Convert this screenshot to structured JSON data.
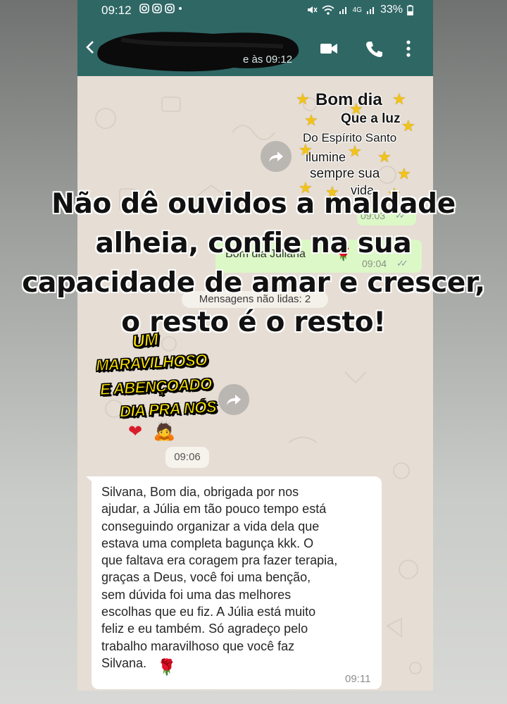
{
  "status_bar": {
    "time": "09:12",
    "left_icons": [
      "instagram-icon",
      "instagram-icon",
      "instagram-icon",
      "dot-icon"
    ],
    "right_icons": [
      "mute-icon",
      "wifi-icon",
      "signal-icon",
      "4g-icon",
      "signal-icon"
    ],
    "network": "4G",
    "battery": "33%"
  },
  "header": {
    "last_seen": "e às 09:12",
    "actions": [
      "video-call-icon",
      "phone-call-icon",
      "more-vert-icon"
    ]
  },
  "chat": {
    "sticker_bom_dia": {
      "lines": [
        "Bom dia",
        "Que a luz",
        "Do Espírito Santo",
        "ilumine",
        "sempre sua",
        "vida"
      ],
      "time": "09:03"
    },
    "outgoing_message": {
      "text": "Bom dia Juliana",
      "emoji": "🌹",
      "time": "09:04"
    },
    "unread_divider": "Mensagens não lidas: 2",
    "sticker_maravilhoso": {
      "lines": [
        "UM",
        "MARAVILHOSO",
        "E ABENÇOADO",
        "DIA PRA NÓS"
      ],
      "emojis": [
        "❤",
        "🙇"
      ]
    },
    "sticker_time": "09:06",
    "incoming_message": {
      "text": "Silvana, Bom dia, obrigada por nos\najudar, a Júlia em tão pouco tempo está\nconseguindo organizar a vida dela que\nestava uma completa  bagunça kkk. O\nque faltava era coragem pra fazer terapia,\ngraças a Deus, você foi uma benção,\nsem dúvida foi uma das melhores\nescolhas que eu fiz. A Júlia está muito\nfeliz e eu também. Só agradeço pelo\ntrabalho maravilhoso que você faz\nSilvana.",
      "emoji": "🌹",
      "time": "09:11"
    }
  },
  "overlay": {
    "quote": "Não dê ouvidos a maldade\nalheia, confie na sua\ncapacidade de amar e crescer,\no resto é o resto!"
  },
  "colors": {
    "header": "#2f6765",
    "chat_bg": "#e6ddd4",
    "outgoing_bubble": "#dcf8c6",
    "incoming_bubble": "#ffffff",
    "sticker_yellow": "#ffe600",
    "star": "#f2c318"
  }
}
